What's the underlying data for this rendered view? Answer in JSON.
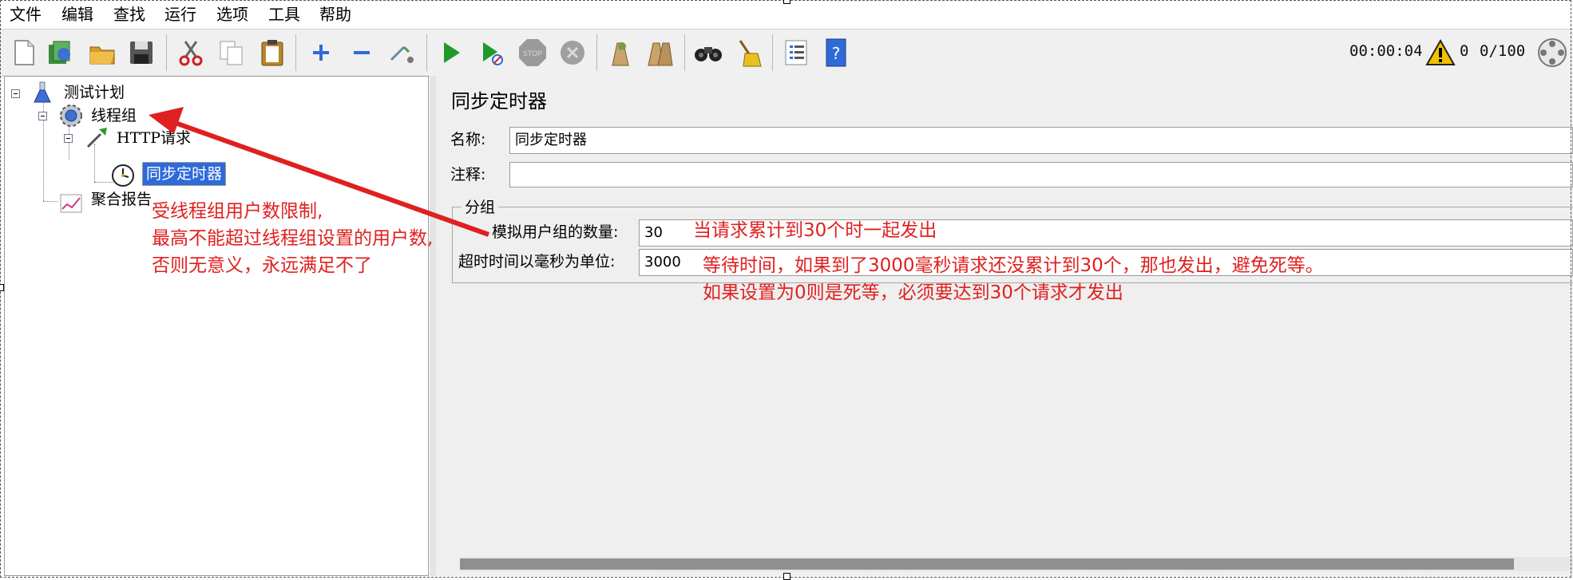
{
  "menu": [
    "文件",
    "编辑",
    "查找",
    "运行",
    "选项",
    "工具",
    "帮助"
  ],
  "toolbar": {
    "elapsed_time": "00:00:04",
    "warning_count": "0",
    "threads": "0/100",
    "icons": [
      "new-icon",
      "templates-icon",
      "open-icon",
      "save-icon",
      "cut-icon",
      "copy-icon",
      "paste-icon",
      "expand-icon",
      "collapse-icon",
      "toggle-icon",
      "start-icon",
      "start-no-pause-icon",
      "stop-icon",
      "shutdown-icon",
      "clear-icon",
      "clear-all-icon",
      "search-icon",
      "reset-search-icon",
      "function-helper-icon",
      "help-icon"
    ]
  },
  "tree": {
    "test_plan": "测试计划",
    "thread_group": "线程组",
    "http_request": "HTTP请求",
    "sync_timer": "同步定时器",
    "aggregate_report": "聚合报告"
  },
  "panel": {
    "title": "同步定时器",
    "name_label": "名称:",
    "name_value": "同步定时器",
    "comment_label": "注释:",
    "comment_value": "",
    "group_legend": "分组",
    "users_label": "模拟用户组的数量:",
    "users_value": "30",
    "timeout_label": "超时时间以毫秒为单位:",
    "timeout_value": "3000"
  },
  "annotations": {
    "left_line1": "受线程组用户数限制,",
    "left_line2": "最高不能超过线程组设置的用户数,",
    "left_line3": "否则无意义，永远满足不了",
    "users_note": "当请求累计到30个时一起发出",
    "timeout_line1": "等待时间，如果到了3000毫秒请求还没累计到30个，那也发出，避免死等。",
    "timeout_line2": "如果设置为0则是死等，必须要达到30个请求才发出"
  },
  "colors": {
    "annotation_red": "#e02020",
    "selection_blue": "#2f6ad9"
  }
}
